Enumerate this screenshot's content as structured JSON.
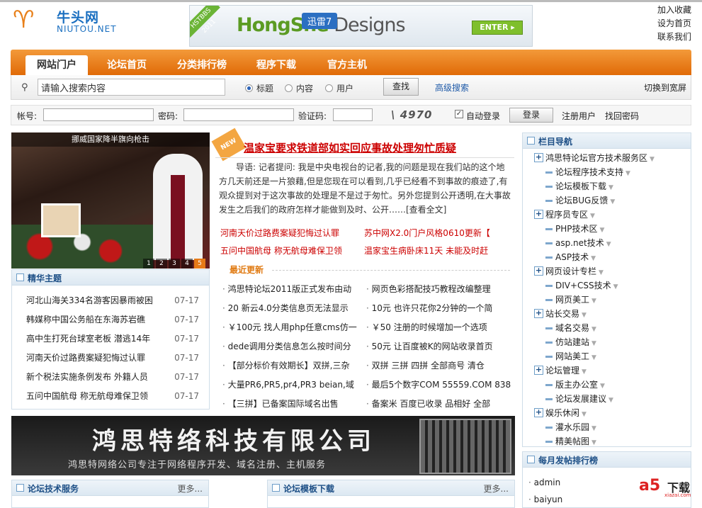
{
  "logo": {
    "cn": "牛头网",
    "en": "NIUTOU.NET",
    "mark": "♈"
  },
  "banner": {
    "ribbon": "HSTBBS 2011",
    "brand": "HongShe",
    "brand_rest": " Designs",
    "xunlei": "迅雷7",
    "enter": "ENTER ▸"
  },
  "top_links": [
    "加入收藏",
    "设为首页",
    "联系我们"
  ],
  "nav": {
    "tabs": [
      "网站门户",
      "论坛首页",
      "分类排行榜",
      "程序下载",
      "官方主机"
    ],
    "active": 0
  },
  "search": {
    "icon": "search-icon",
    "value": "请输入搜索内容",
    "options": [
      "标题",
      "内容",
      "用户"
    ],
    "selected": 0,
    "button": "查找",
    "advanced": "高级搜索",
    "wide": "切换到宽屏"
  },
  "login": {
    "account_label": "帐号:",
    "password_label": "密码:",
    "captcha_label": "验证码:",
    "captcha": "4970",
    "remember": "自动登录",
    "login_button": "登录",
    "register": "注册用户",
    "forgot": "找回密码"
  },
  "photo": {
    "caption": "挪威国家降半旗向枪击",
    "pages": [
      "1",
      "2",
      "3",
      "4",
      "5"
    ],
    "active_page": 4
  },
  "featured": {
    "title": "精华主题",
    "items": [
      {
        "t": "河北山海关334名游客因暴雨被困",
        "d": "07-17"
      },
      {
        "t": "韩媒称中国公务船在东海苏岩礁",
        "d": "07-17"
      },
      {
        "t": "高中生打死台球室老板 潜逃14年",
        "d": "07-17"
      },
      {
        "t": "河南天价过路费案疑犯悔过认罪",
        "d": "07-17"
      },
      {
        "t": "新个税法实施条例发布 外籍人员",
        "d": "07-17"
      },
      {
        "t": "五问中国航母 称无航母难保卫领",
        "d": "07-17"
      }
    ]
  },
  "headline": {
    "new": "NEW",
    "title": "温家宝要求铁道部如实回应事故处理匆忙质疑",
    "summary": "导语: 记者提问: 我是中央电视台的记者,我的问题是现在我们站的这个地方几天前还是一片狼藉,但是您现在可以看到,几乎已经看不到事故的痕迹了,有观众提到对于这次事故的处理是不是过于匆忙。另外您提到公开透明,在大事故发生之后我们的政府怎样才能做到及时、公开……[查看全文]"
  },
  "red_links": [
    "河南天价过路费案疑犯悔过认罪",
    "苏中网X2.0门户风格0610更新【",
    "五问中国航母 称无航母难保卫领",
    "温家宝生病卧床11天 未能及时赶"
  ],
  "recent": {
    "title": "最近更新",
    "left": [
      "鸿思特论坛2011版正式发布由动",
      "20 新云4.0分类信息页无法显示",
      "￥100元 找人用php任意cms仿一",
      "dede调用分类信息怎么按时间分",
      "【部分标价有效期长】双拼,三杂",
      "大量PR6,PR5,pr4,PR3 beian,域",
      "【三拼】已备案国际域名出售"
    ],
    "right": [
      "网页色彩搭配技巧教程改编整理",
      "10元 也许只花你2分钟的一个简",
      "￥50 注册的时候增加一个选项",
      "50元 让百度被K的网站收录首页",
      "双拼 三拼 四拼 全部商号 清仓",
      "最后5个数字COM 55559.COM 838",
      "备案米 百度已收录 品相好 全部"
    ]
  },
  "ad": {
    "title": "鸿思特络科技有限公司",
    "subtitle": "鸿思特网络公司专注于网络程序开发、域名注册、主机服务"
  },
  "sidebar": {
    "title": "栏目导航",
    "tree": [
      {
        "type": "p",
        "t": "鸿思特论坛官方技术服务区"
      },
      {
        "type": "c",
        "t": "论坛程序技术支持"
      },
      {
        "type": "c",
        "t": "论坛模板下载"
      },
      {
        "type": "c",
        "t": "论坛BUG反馈"
      },
      {
        "type": "p",
        "t": "程序员专区"
      },
      {
        "type": "c",
        "t": "PHP技术区"
      },
      {
        "type": "c",
        "t": "asp.net技术"
      },
      {
        "type": "c",
        "t": "ASP技术"
      },
      {
        "type": "p",
        "t": "网页设计专栏"
      },
      {
        "type": "c",
        "t": "DIV+CSS技术"
      },
      {
        "type": "c",
        "t": "网页美工"
      },
      {
        "type": "p",
        "t": "站长交易"
      },
      {
        "type": "c",
        "t": "域名交易"
      },
      {
        "type": "c",
        "t": "仿站建站"
      },
      {
        "type": "c",
        "t": "网站美工"
      },
      {
        "type": "p",
        "t": "论坛管理"
      },
      {
        "type": "c",
        "t": "版主办公室"
      },
      {
        "type": "c",
        "t": "论坛发展建议"
      },
      {
        "type": "p",
        "t": "娱乐休闲"
      },
      {
        "type": "c",
        "t": "灌水乐园"
      },
      {
        "type": "c",
        "t": "精美帖图"
      }
    ]
  },
  "monthly": {
    "title": "每月发帖排行榜",
    "items": [
      "admin",
      "baiyun"
    ]
  },
  "bottom_boxes": [
    {
      "title": "论坛技术服务",
      "more": "更多..."
    },
    {
      "title": "论坛模板下载",
      "more": "更多..."
    }
  ],
  "watermark": {
    "a5": "a5",
    "text": "下载",
    "url": "xiazai.com"
  },
  "colors": {
    "accent": "#e06a07",
    "link": "#1f5aa8",
    "headline": "#cc0000",
    "box_title": "#1d4f86"
  }
}
